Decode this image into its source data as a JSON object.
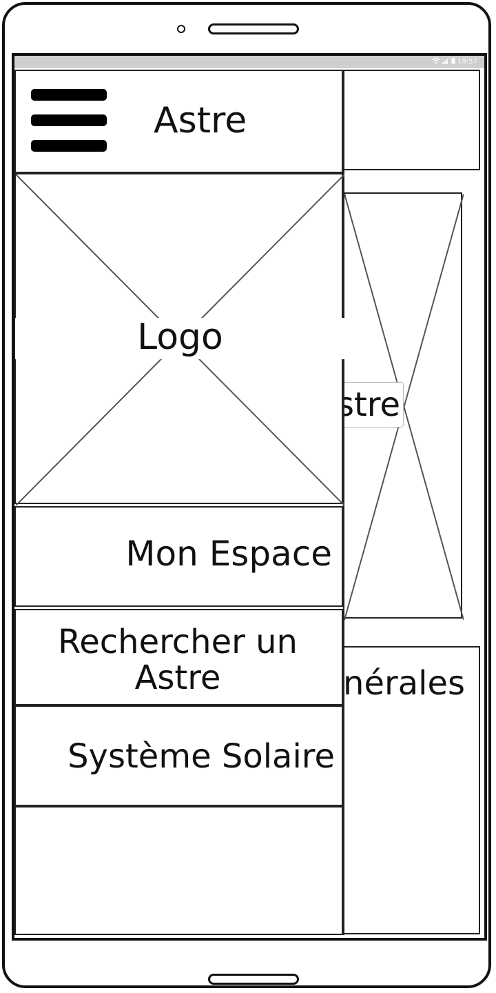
{
  "status_bar": {
    "time": "19:57",
    "icons": [
      "wifi-icon",
      "signal-icon",
      "battery-icon"
    ]
  },
  "drawer": {
    "title": "Astre",
    "logo_label": "Logo",
    "menu": [
      {
        "label": "Mon Espace"
      },
      {
        "label": "Rechercher un Astre"
      },
      {
        "label": "Système Solaire"
      }
    ]
  },
  "background_page": {
    "search_button_partial": "stre",
    "info_section_partial": "nérales"
  },
  "colors": {
    "stroke": "#222222",
    "status_bar": "#cfcfcf",
    "background": "#ffffff"
  }
}
